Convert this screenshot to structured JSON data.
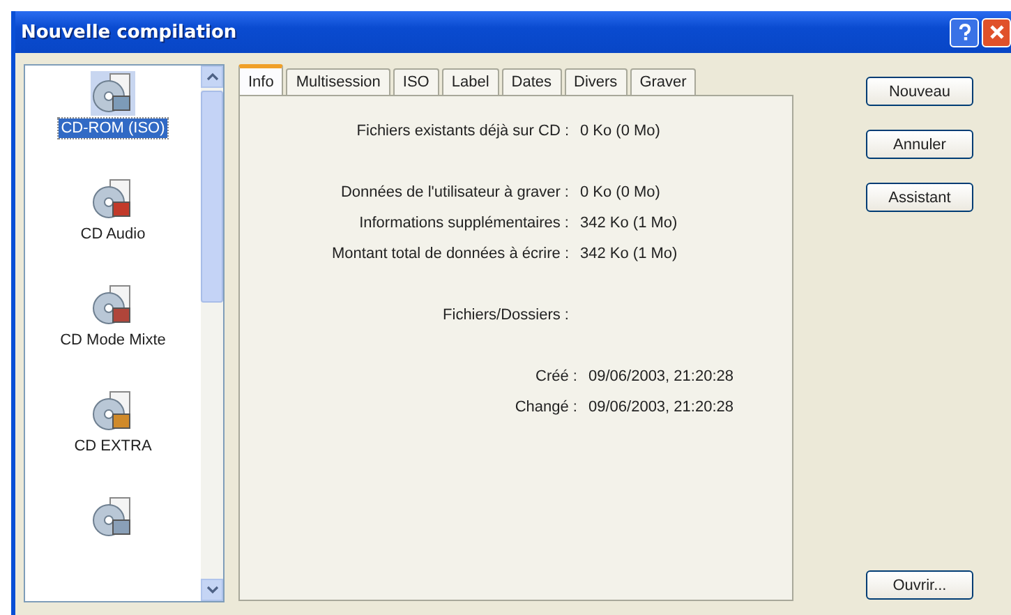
{
  "window": {
    "title": "Nouvelle compilation"
  },
  "compilation_types": [
    {
      "label": "CD-ROM (ISO)",
      "selected": true
    },
    {
      "label": "CD Audio",
      "selected": false
    },
    {
      "label": "CD Mode Mixte",
      "selected": false
    },
    {
      "label": "CD EXTRA",
      "selected": false
    },
    {
      "selected": false
    }
  ],
  "tabs": [
    {
      "label": "Info",
      "selected": true
    },
    {
      "label": "Multisession",
      "selected": false
    },
    {
      "label": "ISO",
      "selected": false
    },
    {
      "label": "Label",
      "selected": false
    },
    {
      "label": "Dates",
      "selected": false
    },
    {
      "label": "Divers",
      "selected": false
    },
    {
      "label": "Graver",
      "selected": false
    }
  ],
  "info_rows": [
    {
      "kind": "pair",
      "label": "Fichiers existants déjà sur CD :",
      "value": "0 Ko (0 Mo)"
    },
    {
      "kind": "gap"
    },
    {
      "kind": "pair",
      "label": "Données de l'utilisateur à graver :",
      "value": "0 Ko (0 Mo)"
    },
    {
      "kind": "pair",
      "label": "Informations supplémentaires :",
      "value": "342 Ko (1 Mo)"
    },
    {
      "kind": "pair",
      "label": "Montant total de données à écrire :",
      "value": "342 Ko (1 Mo)"
    },
    {
      "kind": "gap"
    },
    {
      "kind": "heading",
      "label": "Fichiers/Dossiers :"
    },
    {
      "kind": "gap"
    },
    {
      "kind": "date",
      "label": "Créé :",
      "value": "09/06/2003, 21:20:28"
    },
    {
      "kind": "date",
      "label": "Changé :",
      "value": "09/06/2003, 21:20:28"
    }
  ],
  "buttons": [
    "Nouveau",
    "Annuler",
    "Assistant"
  ],
  "bottom_button": "Ouvrir..."
}
